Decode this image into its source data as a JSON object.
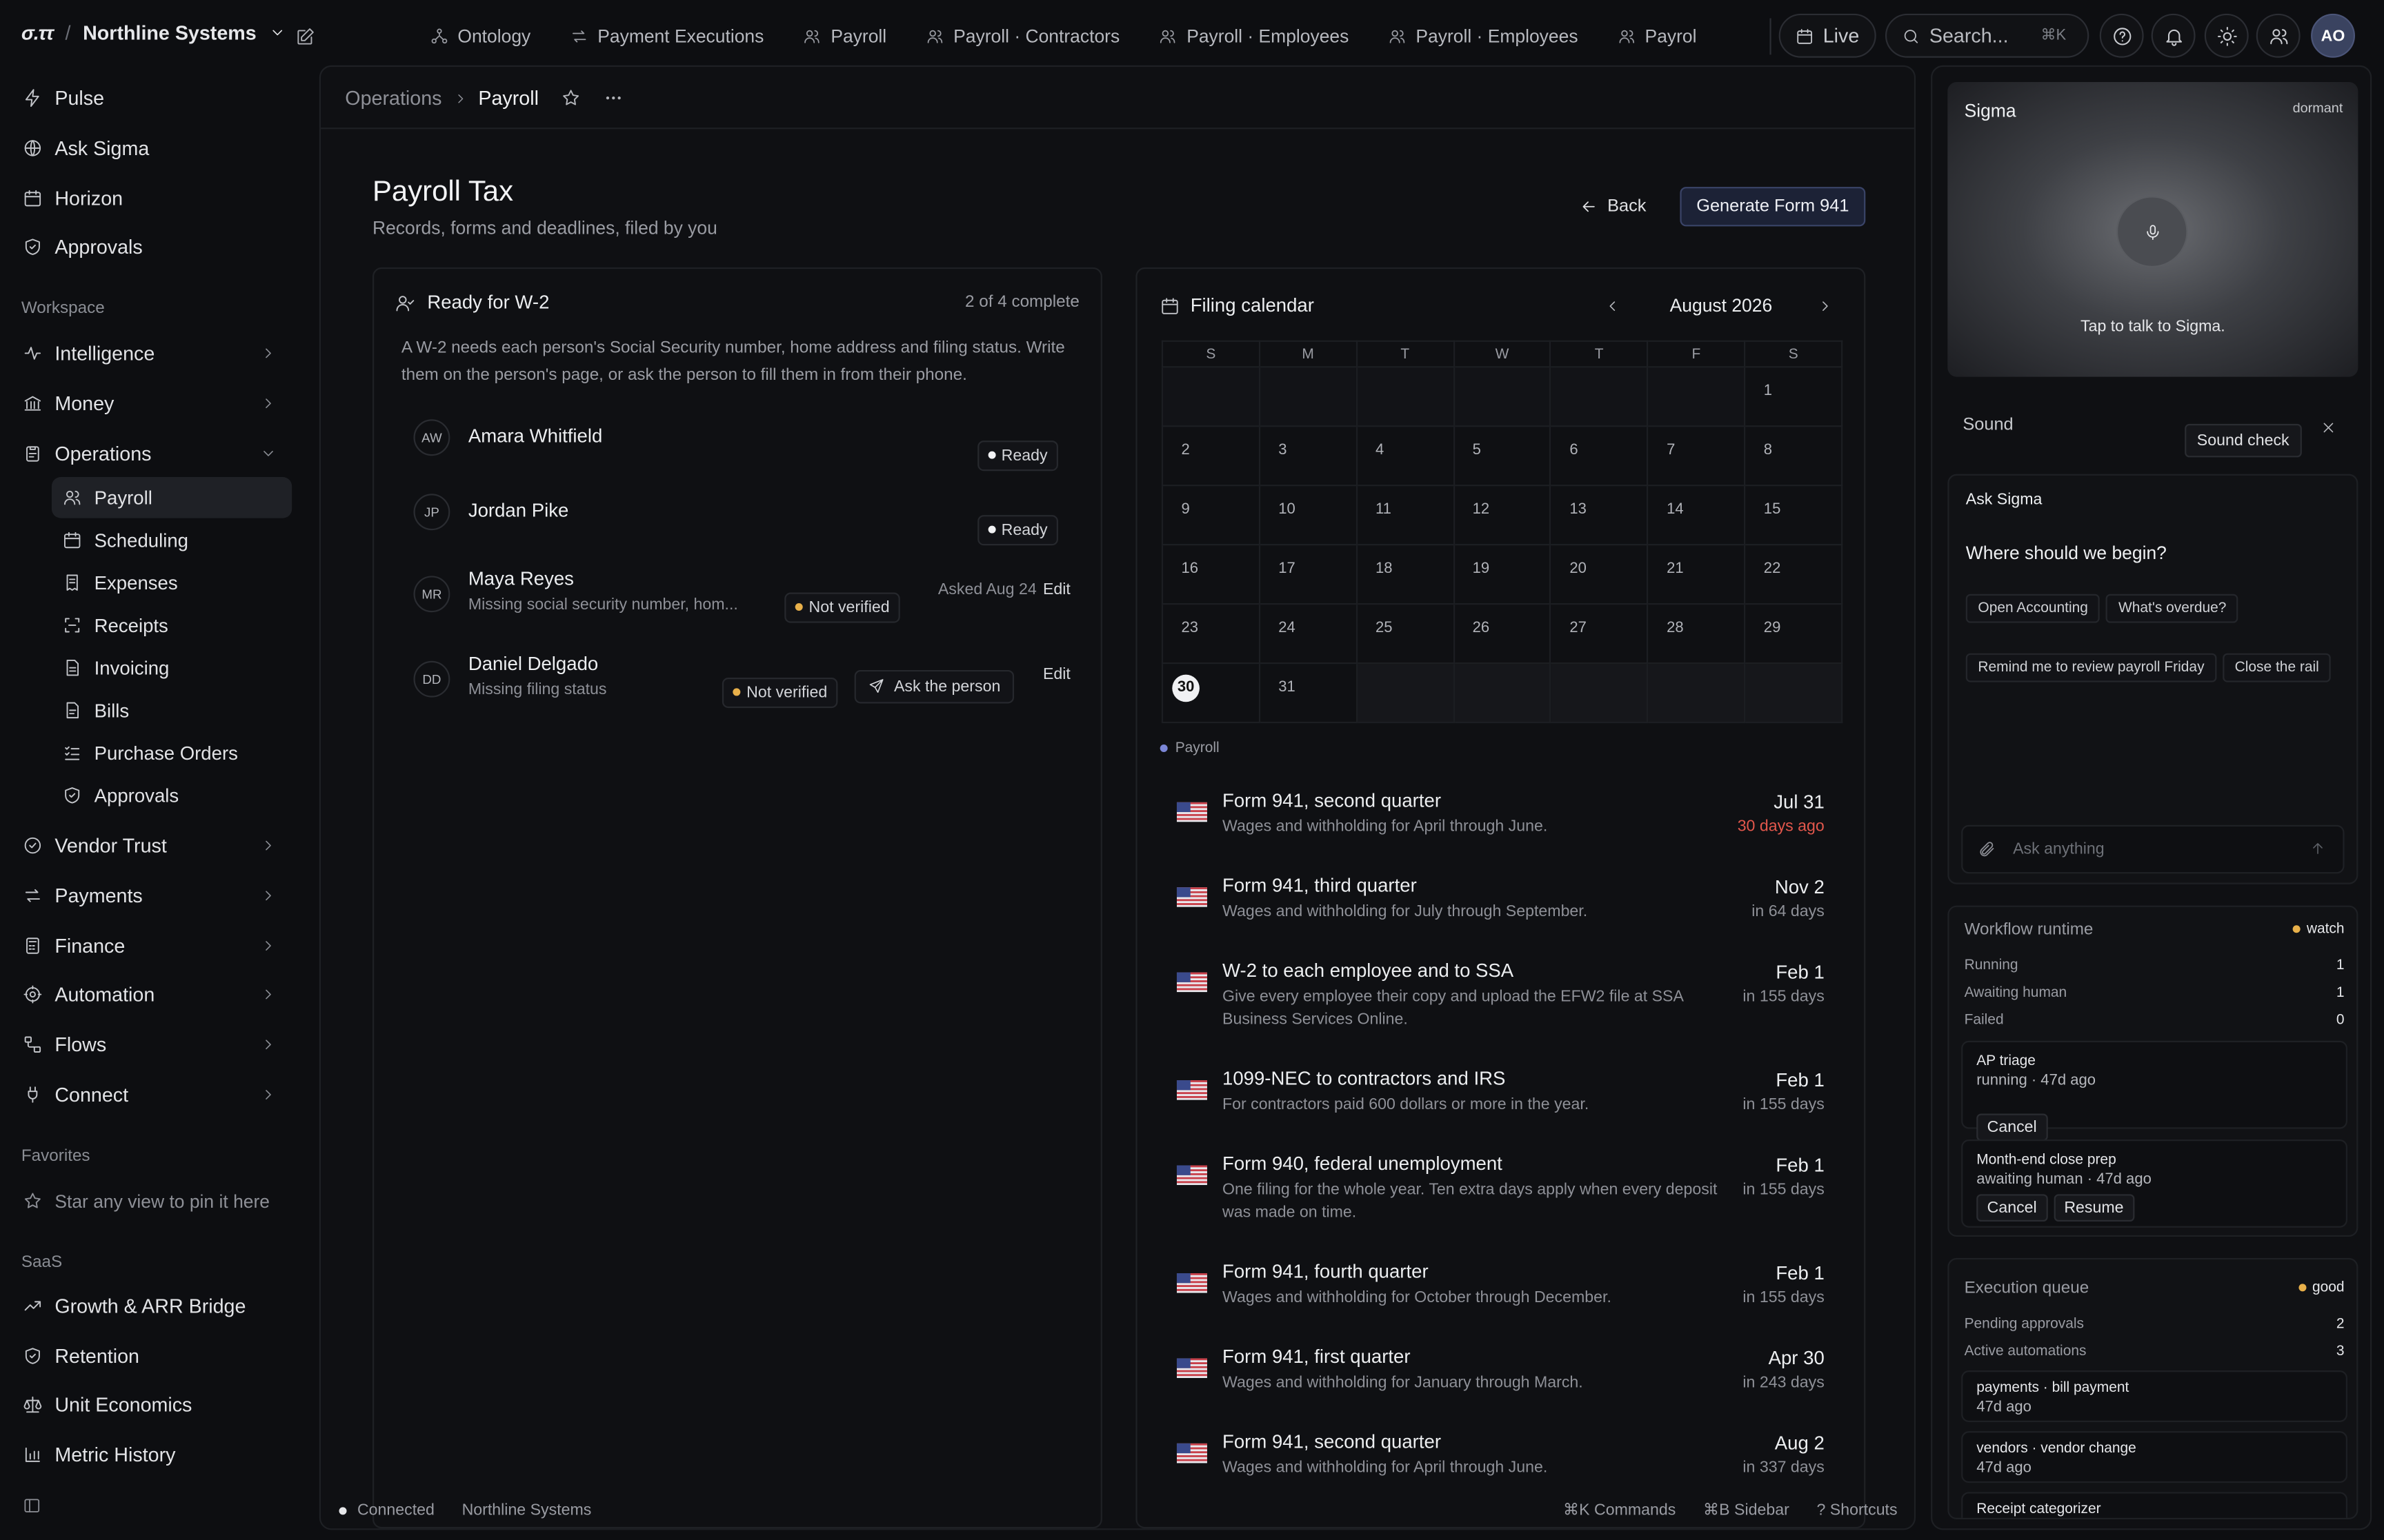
{
  "app": {
    "logo": "σ.ττ",
    "org": "Northline Systems"
  },
  "topbar": {
    "tabs": [
      "Ontology",
      "Payment Executions",
      "Payroll",
      "Payroll · Contractors",
      "Payroll · Employees",
      "Payroll · Employees",
      "Payrol"
    ],
    "live": "Live",
    "search": "Search...",
    "search_kbd": "⌘K",
    "user_initials": "AO"
  },
  "sidebar": {
    "top": [
      "Pulse",
      "Ask Sigma",
      "Horizon",
      "Approvals"
    ],
    "workspace_label": "Workspace",
    "workspace": [
      "Intelligence",
      "Money",
      "Operations"
    ],
    "operations_sub": [
      "Payroll",
      "Scheduling",
      "Expenses",
      "Receipts",
      "Invoicing",
      "Bills",
      "Purchase Orders",
      "Approvals"
    ],
    "more": [
      "Vendor Trust",
      "Payments",
      "Finance",
      "Automation",
      "Flows",
      "Connect"
    ],
    "favorites_label": "Favorites",
    "favorites_hint": "Star any view to pin it here",
    "saas_label": "SaaS",
    "saas": [
      "Growth & ARR Bridge",
      "Retention",
      "Unit Economics",
      "Metric History"
    ]
  },
  "main": {
    "breadcrumb": {
      "parent": "Operations",
      "current": "Payroll"
    },
    "title": "Payroll Tax",
    "subtitle": "Records, forms and deadlines, filed by you",
    "back": "Back",
    "generate": "Generate Form 941"
  },
  "w2": {
    "title": "Ready for W-2",
    "progress": "2 of 4 complete",
    "intro": "A W-2 needs each person's Social Security number, home address and filing status. Write them on the person's page, or ask the person to fill them in from their phone.",
    "people": [
      {
        "initials": "AW",
        "name": "Amara Whitfield",
        "note": "",
        "status": "Ready"
      },
      {
        "initials": "JP",
        "name": "Jordan Pike",
        "note": "",
        "status": "Ready"
      },
      {
        "initials": "MR",
        "name": "Maya Reyes",
        "note": "Missing social security number, hom...",
        "status": "Not verified",
        "asked": "Asked Aug 24",
        "edit": "Edit"
      },
      {
        "initials": "DD",
        "name": "Daniel Delgado",
        "note": "Missing filing status",
        "status": "Not verified",
        "ask": "Ask the person",
        "edit": "Edit"
      }
    ]
  },
  "calendar": {
    "title": "Filing calendar",
    "month": "August 2026",
    "weekdays": [
      "S",
      "M",
      "T",
      "W",
      "T",
      "F",
      "S"
    ],
    "legend": "Payroll",
    "today": 30
  },
  "filings": [
    {
      "title": "Form 941, second quarter",
      "desc": "Wages and withholding for April through June.",
      "date": "Jul 31",
      "rel": "30 days ago",
      "overdue": true
    },
    {
      "title": "Form 941, third quarter",
      "desc": "Wages and withholding for July through September.",
      "date": "Nov 2",
      "rel": "in 64 days"
    },
    {
      "title": "W-2 to each employee and to SSA",
      "desc": "Give every employee their copy and upload the EFW2 file at SSA Business Services Online.",
      "date": "Feb 1",
      "rel": "in 155 days"
    },
    {
      "title": "1099-NEC to contractors and IRS",
      "desc": "For contractors paid 600 dollars or more in the year.",
      "date": "Feb 1",
      "rel": "in 155 days"
    },
    {
      "title": "Form 940, federal unemployment",
      "desc": "One filing for the whole year. Ten extra days apply when every deposit was made on time.",
      "date": "Feb 1",
      "rel": "in 155 days"
    },
    {
      "title": "Form 941, fourth quarter",
      "desc": "Wages and withholding for October through December.",
      "date": "Feb 1",
      "rel": "in 155 days"
    },
    {
      "title": "Form 941, first quarter",
      "desc": "Wages and withholding for January through March.",
      "date": "Apr 30",
      "rel": "in 243 days"
    },
    {
      "title": "Form 941, second quarter",
      "desc": "Wages and withholding for April through June.",
      "date": "Aug 2",
      "rel": "in 337 days"
    }
  ],
  "footer": {
    "status": "Connected",
    "org": "Northline Systems",
    "cmd": "⌘K Commands",
    "side": "⌘B Sidebar",
    "help": "? Shortcuts"
  },
  "rail": {
    "sigma": {
      "title": "Sigma",
      "state": "dormant",
      "hint": "Tap to talk to Sigma."
    },
    "sound": {
      "label": "Sound",
      "check": "Sound check"
    },
    "ask": {
      "title": "Ask Sigma",
      "prompt": "Where should we begin?",
      "suggestions": [
        "Open Accounting",
        "What's overdue?",
        "Remind me to review payroll Friday",
        "Close the rail"
      ],
      "placeholder": "Ask anything"
    },
    "workflow": {
      "title": "Workflow runtime",
      "badge": "watch",
      "rows": [
        [
          "Running",
          "1"
        ],
        [
          "Awaiting human",
          "1"
        ],
        [
          "Failed",
          "0"
        ]
      ],
      "items": [
        {
          "name": "AP triage",
          "meta": "running · 47d ago",
          "actions": [
            "Cancel"
          ]
        },
        {
          "name": "Month-end close prep",
          "meta": "awaiting human · 47d ago",
          "actions": [
            "Cancel",
            "Resume"
          ]
        }
      ]
    },
    "queue": {
      "title": "Execution queue",
      "badge": "good",
      "rows": [
        [
          "Pending approvals",
          "2"
        ],
        [
          "Active automations",
          "3"
        ]
      ],
      "items": [
        {
          "name": "payments · bill payment",
          "meta": "47d ago"
        },
        {
          "name": "vendors · vendor change",
          "meta": "47d ago"
        },
        {
          "name": "Receipt categorizer",
          "meta": ""
        }
      ]
    }
  },
  "colors": {
    "accent": "#2a3350",
    "ready": "#f1f2f4",
    "warn": "#e8b04a",
    "overdue": "#e2574c",
    "payroll_dot": "#7b86d6",
    "watch": "#e8b04a",
    "good": "#e8b04a"
  }
}
